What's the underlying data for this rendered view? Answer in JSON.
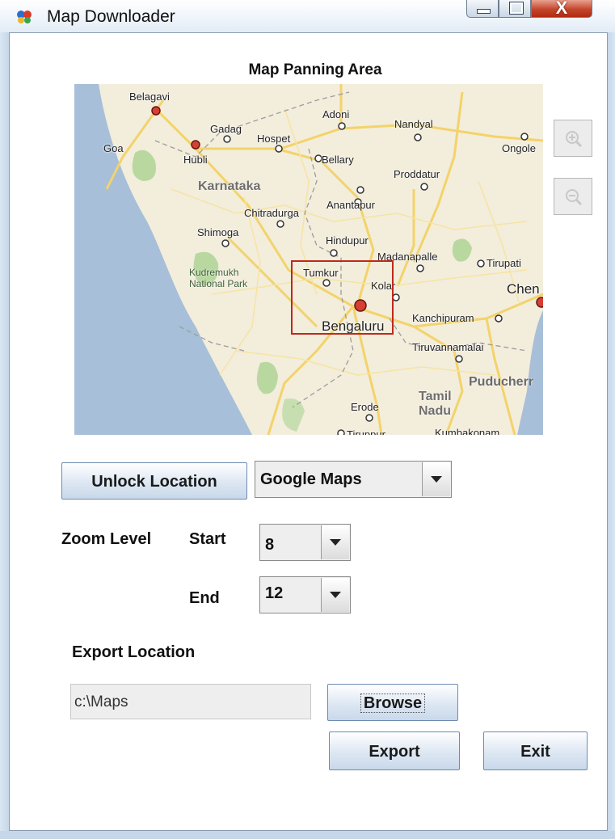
{
  "window": {
    "title": "Map Downloader"
  },
  "map": {
    "title": "Map Panning Area",
    "regions": [
      "Karnataka",
      "Tamil Nadu"
    ],
    "park": "Kudremukh National Park",
    "cities": [
      "Belagavi",
      "Goa",
      "Gadag",
      "Hospet",
      "Adoni",
      "Nandyal",
      "Ongole",
      "Hubli",
      "Bellary",
      "Proddatur",
      "Chitradurga",
      "Anantapur",
      "Shimoga",
      "Hindupur",
      "Madanapalle",
      "Tirupati",
      "Tumkur",
      "Kolar",
      "Chen",
      "Bengaluru",
      "Kanchipuram",
      "Tiruvannamalai",
      "Puducherr",
      "Erode",
      "Tiruppur",
      "Kumbakonam"
    ]
  },
  "controls": {
    "unlock_label": "Unlock Location",
    "map_source": "Google Maps",
    "zoom_label": "Zoom Level",
    "start_label": "Start",
    "start_value": "8",
    "end_label": "End",
    "end_value": "12",
    "export_location_label": "Export Location",
    "export_path": "c:\\Maps",
    "browse_label": "Browse",
    "export_label": "Export",
    "exit_label": "Exit"
  }
}
